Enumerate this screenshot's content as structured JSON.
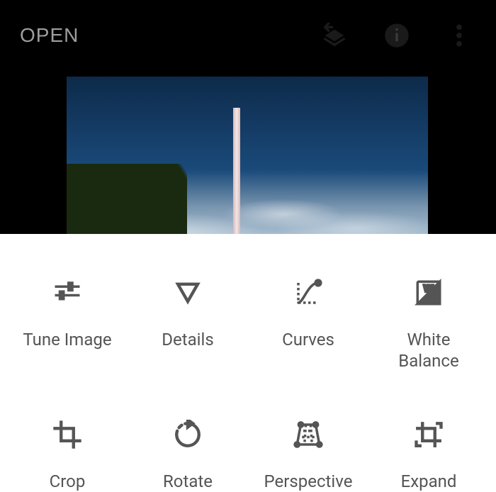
{
  "toolbar": {
    "open_label": "OPEN"
  },
  "tools": {
    "items": [
      {
        "label": "Tune Image"
      },
      {
        "label": "Details"
      },
      {
        "label": "Curves"
      },
      {
        "label": "White\nBalance"
      },
      {
        "label": "Crop"
      },
      {
        "label": "Rotate"
      },
      {
        "label": "Perspective"
      },
      {
        "label": "Expand"
      }
    ]
  }
}
